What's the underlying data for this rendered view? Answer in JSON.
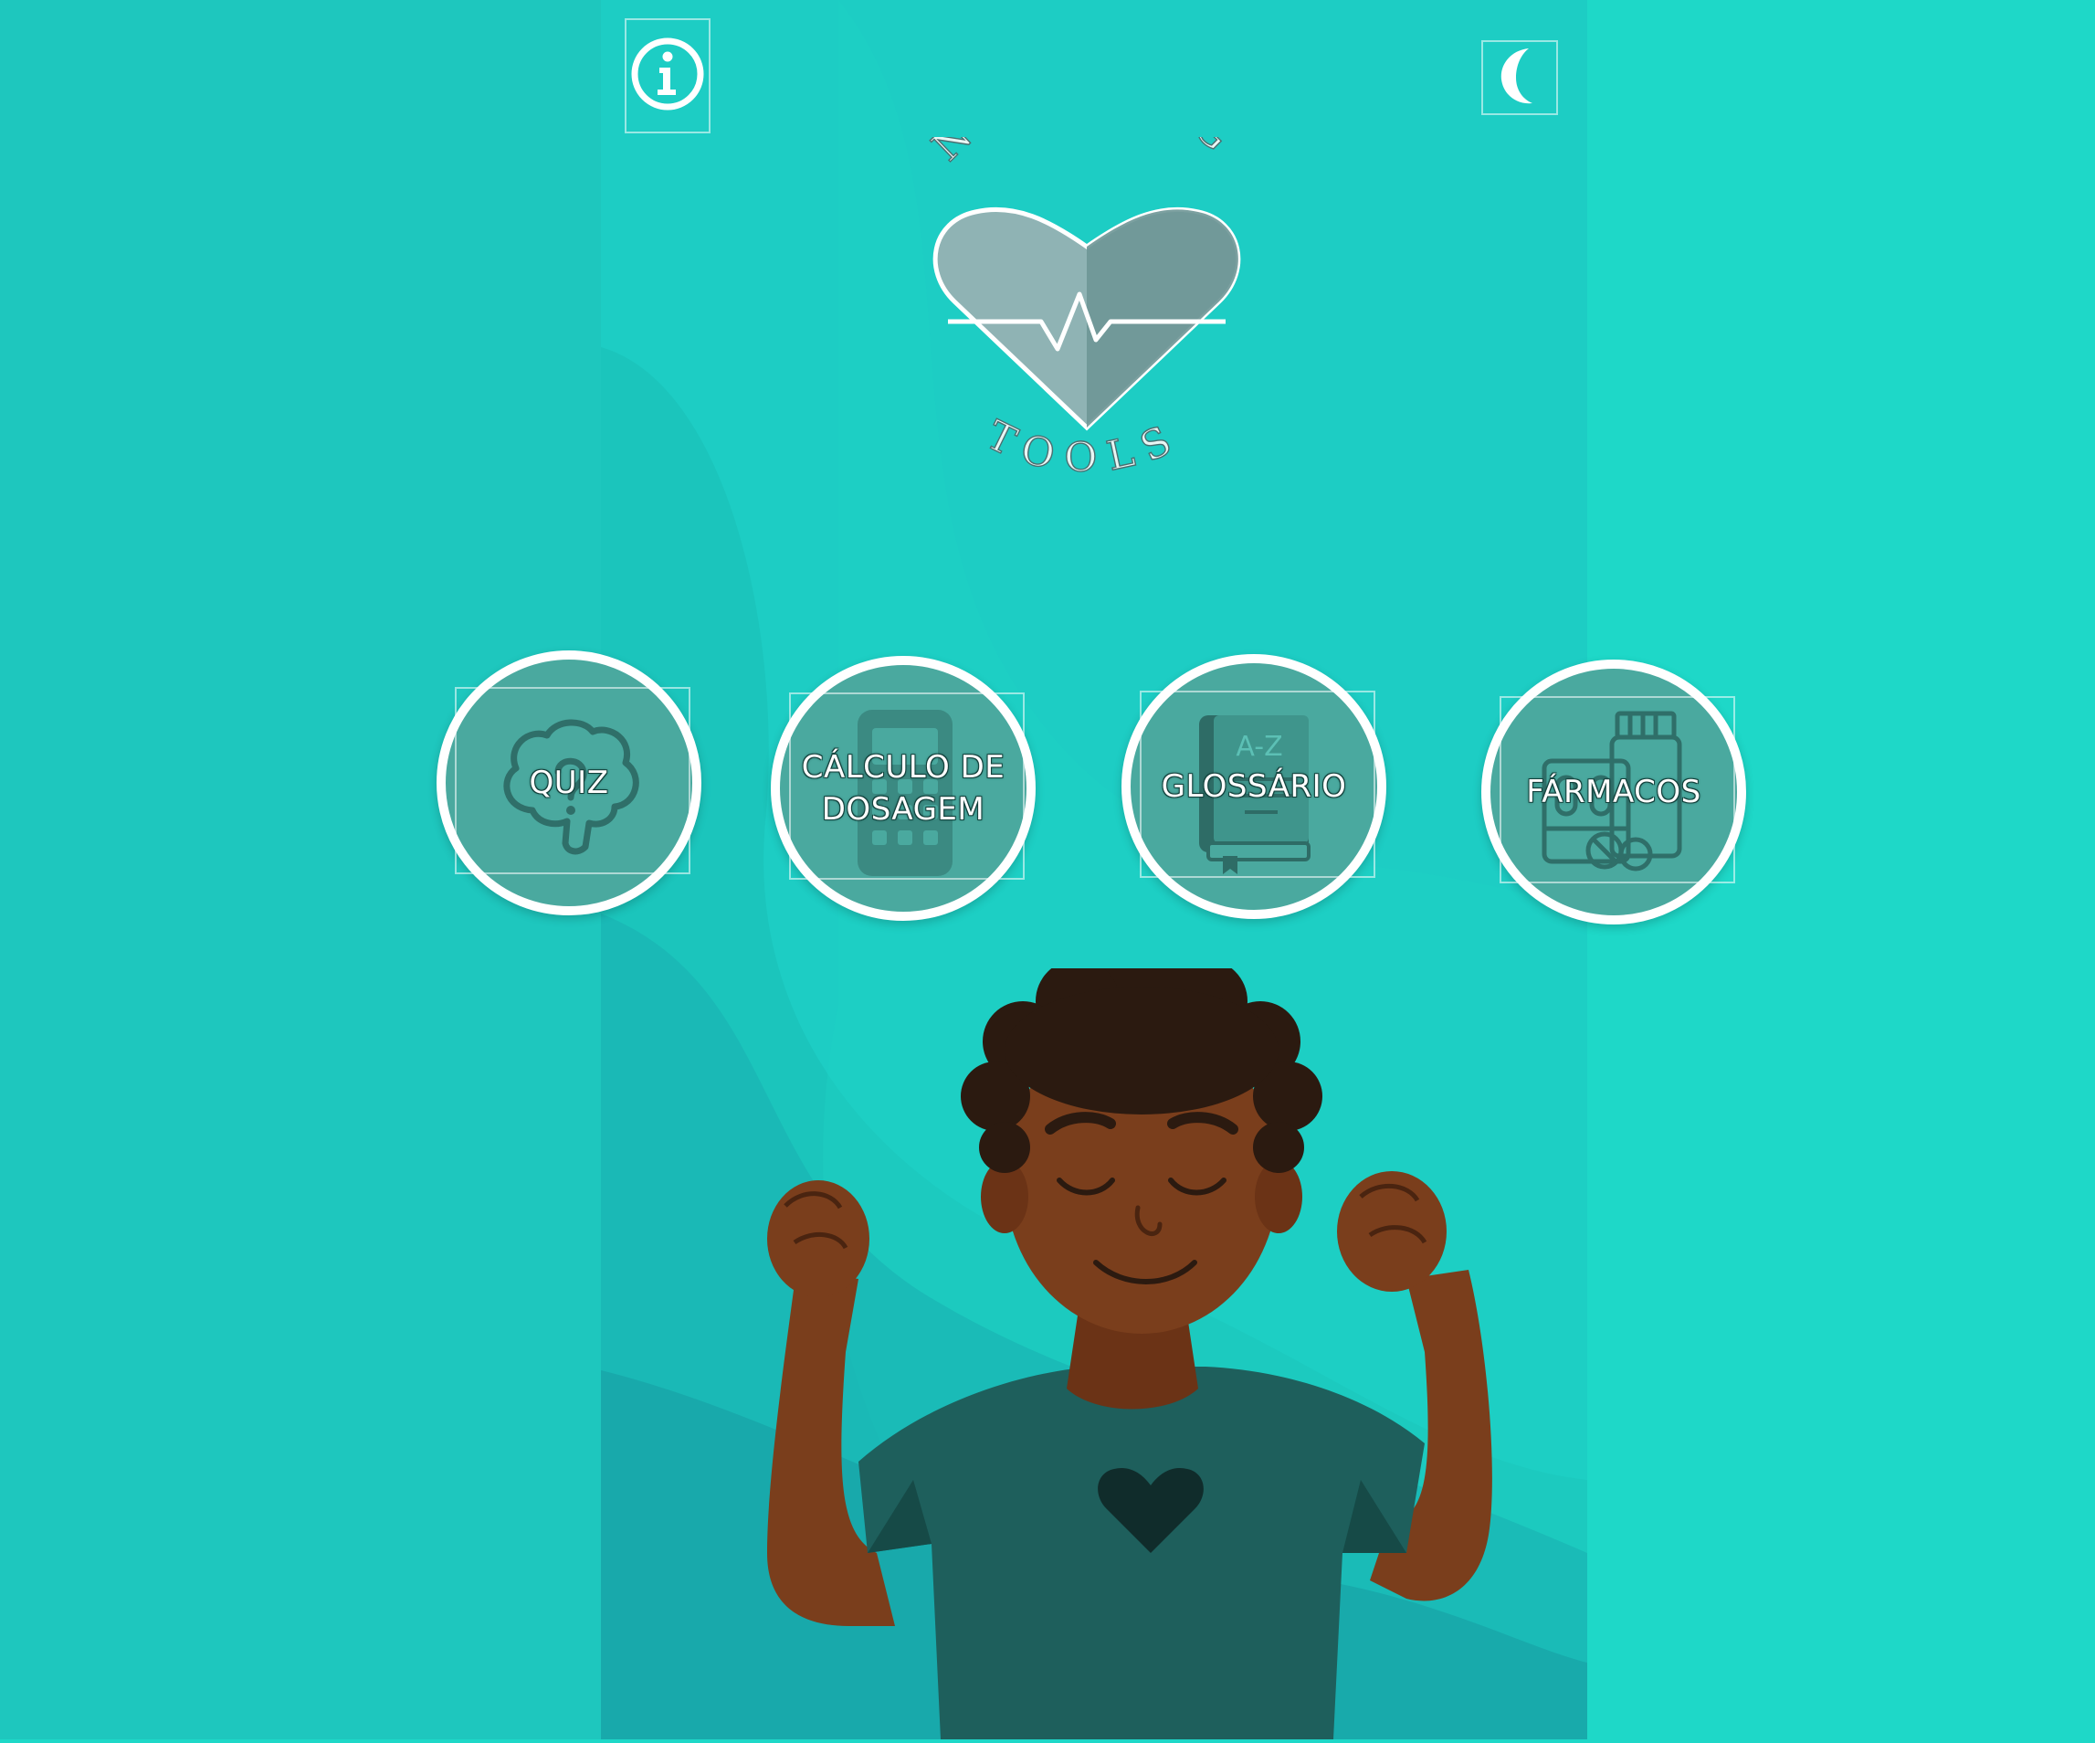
{
  "header": {
    "info_icon": "info-icon",
    "theme_icon": "moon-icon"
  },
  "logo": {
    "top_text": "NURSING",
    "bottom_text": "TOOLS"
  },
  "menu": {
    "items": [
      {
        "label_lines": [
          "QUIZ"
        ],
        "icon": "brain-question-icon"
      },
      {
        "label_lines": [
          "CÁLCULO DE",
          "DOSAGEM"
        ],
        "icon": "calculator-icon"
      },
      {
        "label_lines": [
          "GLOSSÁRIO"
        ],
        "icon": "a-z-book-icon"
      },
      {
        "label_lines": [
          "FÁRMACOS"
        ],
        "icon": "pill-bottles-icon"
      }
    ]
  },
  "colors": {
    "background": "#1ed8c8",
    "button_fill": "#4aa99f",
    "button_ring": "#ffffff"
  }
}
